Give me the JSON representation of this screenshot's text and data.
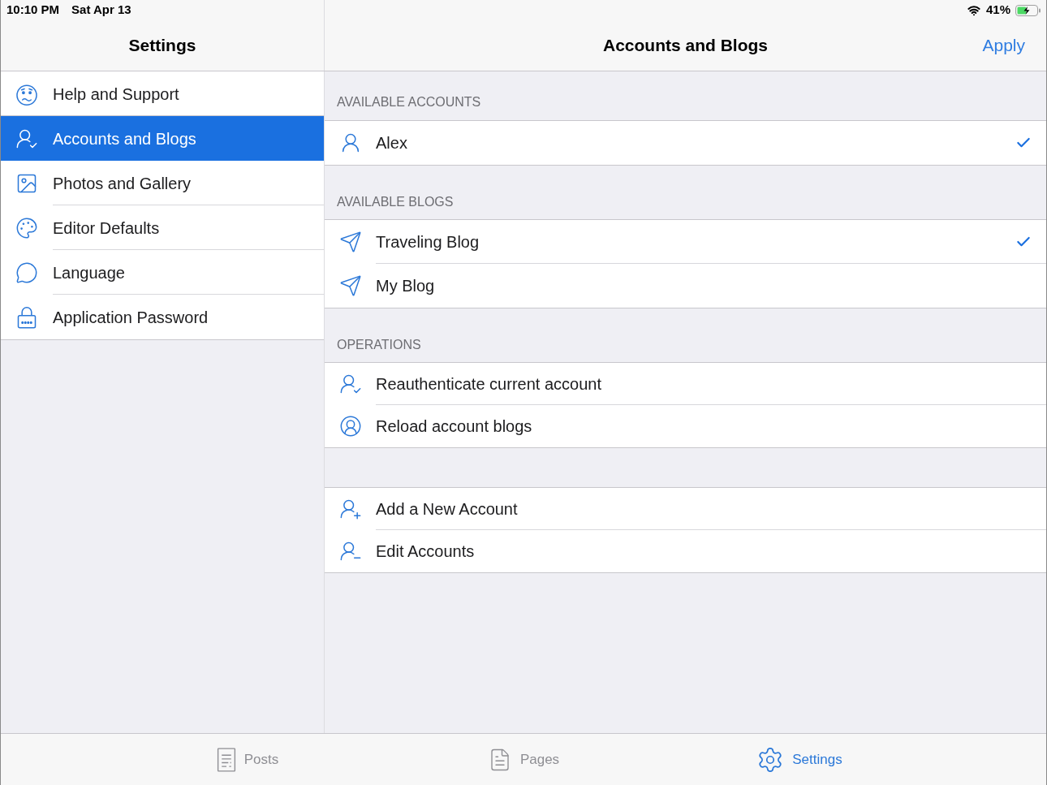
{
  "status_bar": {
    "time": "10:10 PM",
    "date": "Sat Apr 13",
    "battery": "41%"
  },
  "sidebar": {
    "title": "Settings",
    "items": [
      {
        "label": "Help and Support",
        "selected": false
      },
      {
        "label": "Accounts and Blogs",
        "selected": true
      },
      {
        "label": "Photos and Gallery",
        "selected": false
      },
      {
        "label": "Editor Defaults",
        "selected": false
      },
      {
        "label": "Language",
        "selected": false
      },
      {
        "label": "Application Password",
        "selected": false
      }
    ]
  },
  "detail": {
    "title": "Accounts and Blogs",
    "action": "Apply",
    "sections": [
      {
        "header": "AVAILABLE ACCOUNTS",
        "rows": [
          {
            "label": "Alex",
            "checked": true
          }
        ]
      },
      {
        "header": "AVAILABLE BLOGS",
        "rows": [
          {
            "label": "Traveling Blog",
            "checked": true
          },
          {
            "label": "My Blog",
            "checked": false
          }
        ]
      },
      {
        "header": "OPERATIONS",
        "rows": [
          {
            "label": "Reauthenticate current account"
          },
          {
            "label": "Reload account blogs"
          }
        ]
      },
      {
        "rows": [
          {
            "label": "Add a New Account"
          },
          {
            "label": "Edit Accounts"
          }
        ]
      }
    ]
  },
  "tab_bar": [
    {
      "label": "Posts",
      "selected": false
    },
    {
      "label": "Pages",
      "selected": false
    },
    {
      "label": "Settings",
      "selected": true
    }
  ]
}
